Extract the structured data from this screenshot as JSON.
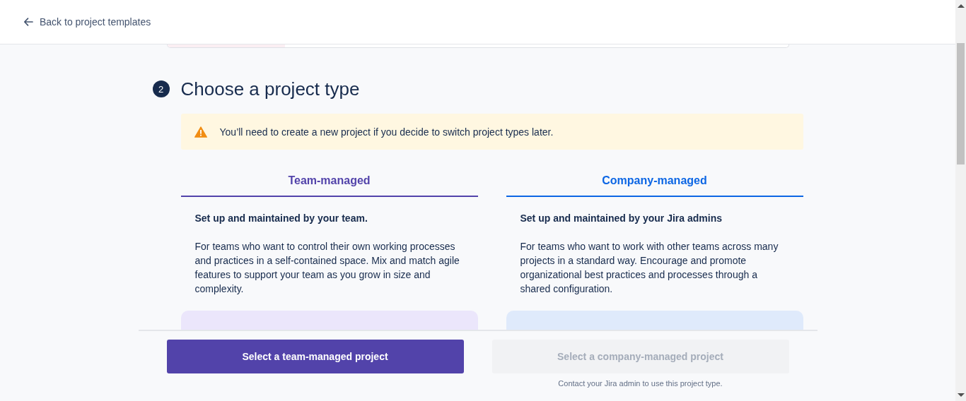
{
  "header": {
    "back_link": "Back to project templates"
  },
  "section": {
    "step": "2",
    "title": "Choose a project type"
  },
  "warning": {
    "text": "You’ll need to create a new project if you decide to switch project types later."
  },
  "project_types": [
    {
      "kind": "team",
      "tab": "Team-managed",
      "heading": "Set up and maintained by your team.",
      "description": "For teams who want to control their own working processes and practices in a self-contained space. Mix and match agile features to support your team as you grow in size and complexity.",
      "button": {
        "label": "Select a team-managed project",
        "disabled": false
      }
    },
    {
      "kind": "company",
      "tab": "Company-managed",
      "heading": "Set up and maintained by your Jira admins",
      "description": "For teams who want to work with other teams across many projects in a standard way. Encourage and promote organizational best practices and processes through a shared configuration.",
      "button": {
        "label": "Select a company-managed project",
        "disabled": true
      },
      "note": "Contact your Jira admin to use this project type."
    }
  ]
}
